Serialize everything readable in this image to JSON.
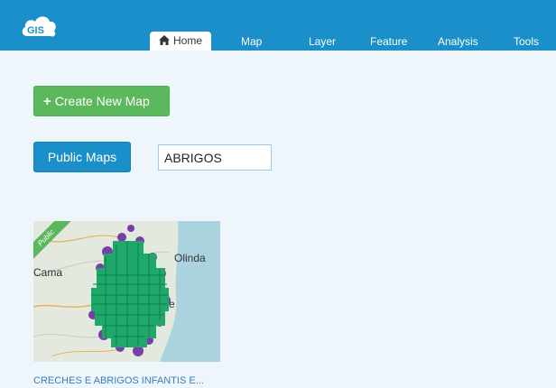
{
  "app": {
    "logo_text": "GIS"
  },
  "nav": {
    "items": [
      {
        "label": "Home",
        "active": true
      },
      {
        "label": "Map"
      },
      {
        "label": "Layer"
      },
      {
        "label": "Feature"
      },
      {
        "label": "Analysis"
      },
      {
        "label": "Tools"
      }
    ]
  },
  "actions": {
    "create_label": "Create New Map",
    "public_maps_label": "Public Maps"
  },
  "search": {
    "value": "ABRIGOS"
  },
  "maps": [
    {
      "title": "CRECHES E ABRIGOS INFANTIS E...",
      "badge": "Public",
      "thumbnail_labels": [
        "Olinda",
        "Cama",
        "e"
      ]
    }
  ],
  "colors": {
    "brand": "#1a8fc9",
    "success": "#5cb85c",
    "map_green": "#1ea86a",
    "map_purple": "#7a3ea8"
  }
}
